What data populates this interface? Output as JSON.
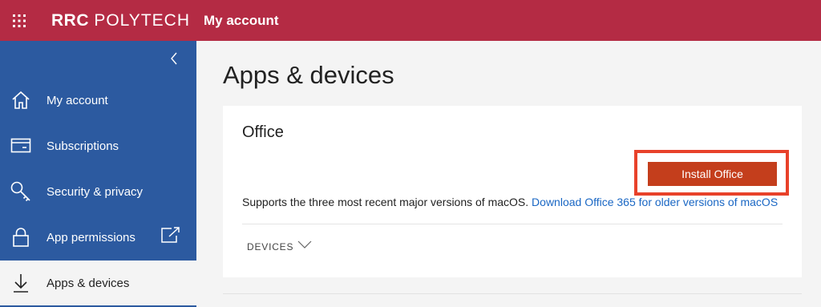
{
  "header": {
    "logo_bold": "RRC",
    "logo_thin": "POLYTECH",
    "app_title": "My account",
    "brand_color": "#b42b44"
  },
  "sidebar": {
    "color": "#2c5aa0",
    "items": [
      {
        "label": "My account",
        "icon": "home-icon"
      },
      {
        "label": "Subscriptions",
        "icon": "card-icon"
      },
      {
        "label": "Security & privacy",
        "icon": "key-icon"
      },
      {
        "label": "App permissions",
        "icon": "lock-icon"
      },
      {
        "label": "Apps & devices",
        "icon": "download-icon"
      }
    ]
  },
  "main": {
    "page_title": "Apps & devices",
    "office_card": {
      "title": "Office",
      "install_label": "Install Office",
      "support_text": "Supports the three most recent major versions of macOS.",
      "support_link": "Download Office 365 for older versions of macOS",
      "devices_label": "DEVICES"
    }
  }
}
